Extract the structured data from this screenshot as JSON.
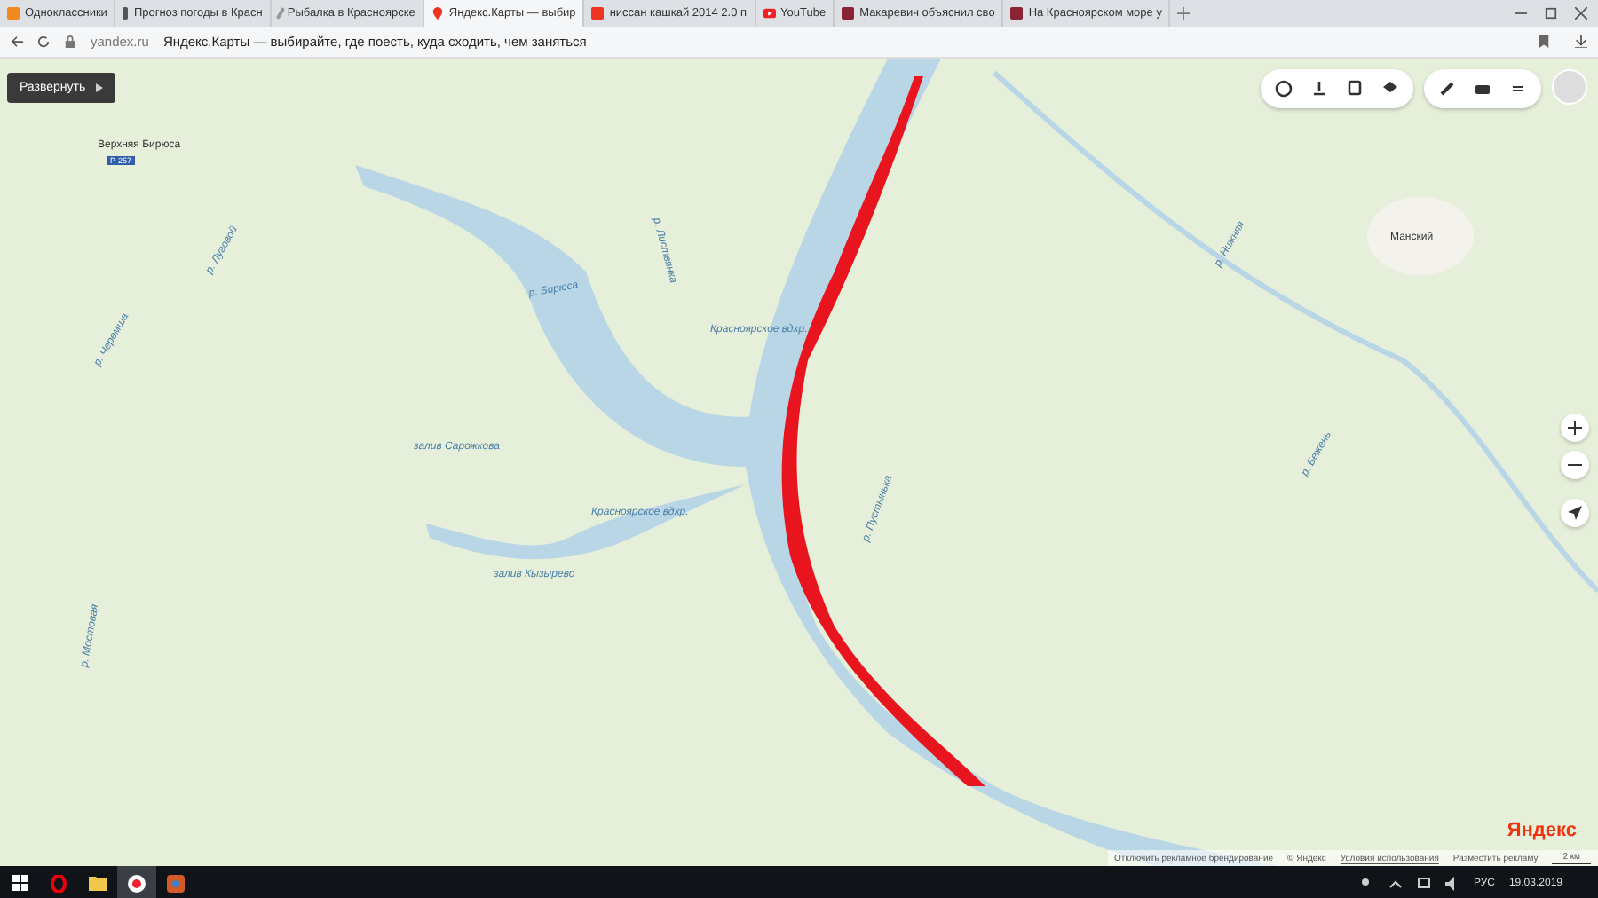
{
  "tabs": [
    {
      "title": "Одноклассники",
      "selected": false
    },
    {
      "title": "Прогноз погоды в Красн",
      "selected": false
    },
    {
      "title": "Рыбалка в Красноярске",
      "selected": false
    },
    {
      "title": "Яндекс.Карты — выбир",
      "selected": true
    },
    {
      "title": "ниссан кашкай 2014 2.0 п",
      "selected": false
    },
    {
      "title": "YouTube",
      "selected": false
    },
    {
      "title": "Макаревич объяснил сво",
      "selected": false
    },
    {
      "title": "На Красноярском море у",
      "selected": false
    }
  ],
  "address_bar": {
    "domain": "yandex.ru",
    "page_title": "Яндекс.Карты — выбирайте, где поесть, куда сходить, чем заняться"
  },
  "map": {
    "expand_button": "Развернуть",
    "labels": [
      {
        "text": "Верхняя Бирюса",
        "kind": "town"
      },
      {
        "text": "Р-257",
        "kind": "road"
      },
      {
        "text": "Манский",
        "kind": "town"
      },
      {
        "text": "Красноярское вдхр.",
        "kind": "water"
      },
      {
        "text": "Красноярское вдхр.",
        "kind": "water"
      },
      {
        "text": "р. Бирюса",
        "kind": "water"
      },
      {
        "text": "залив Сарожкова",
        "kind": "water"
      },
      {
        "text": "залив Кызырево",
        "kind": "water"
      },
      {
        "text": "р. Листвянка",
        "kind": "water"
      },
      {
        "text": "р. Пустынька",
        "kind": "water"
      },
      {
        "text": "р. Черемша",
        "kind": "water"
      },
      {
        "text": "р. Луговой",
        "kind": "water"
      },
      {
        "text": "р. Мостовая",
        "kind": "water"
      },
      {
        "text": "р. Нижняя",
        "kind": "water"
      },
      {
        "text": "р. Бежень",
        "kind": "water"
      }
    ],
    "logo": "Яндекс",
    "footer": [
      "Отключить рекламное брендирование",
      "© Яндекс",
      "Условия использования",
      "Разместить рекламу"
    ],
    "scale": "2 км"
  },
  "taskbar": {
    "language": "РУС",
    "date": "19.03.2019"
  }
}
